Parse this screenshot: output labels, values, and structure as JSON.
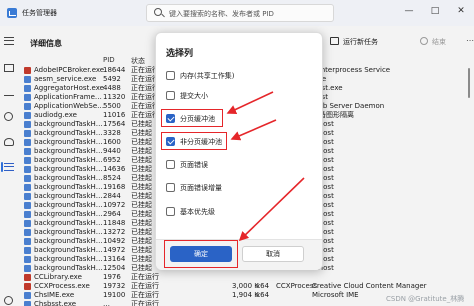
{
  "window": {
    "title": "任务管理器",
    "search_placeholder": "键入要搜索的名称、发布者或 PID",
    "minimize": "—",
    "maximize": "□",
    "close": "✕"
  },
  "page": {
    "title": "详细信息",
    "run_task": "运行新任务",
    "end_task": "结束"
  },
  "columns": {
    "pid": "PID",
    "status": "状态"
  },
  "rows": [
    {
      "name": "AdobeIPCBroker.exe",
      "pid": "18644",
      "status": "正在运行",
      "desc": "d Interprocess Service",
      "icon": "#c0392b"
    },
    {
      "name": "aesm_service.exe",
      "pid": "5492",
      "status": "正在运行",
      "desc": "vice",
      "icon": "#4a7fcf"
    },
    {
      "name": "AggregatorHost.exe",
      "pid": "4488",
      "status": "正在运行",
      "desc": "Host.exe",
      "icon": "#4a7fcf"
    },
    {
      "name": "ApplicationFrame…",
      "pid": "11320",
      "status": "正在运行",
      "desc": "Host",
      "icon": "#4a7fcf"
    },
    {
      "name": "ApplicationWebSe…",
      "pid": "5500",
      "status": "正在运行",
      "desc": "Web Server Daemon",
      "icon": "#4a7fcf"
    },
    {
      "name": "audiodg.exe",
      "pid": "11016",
      "status": "正在运行",
      "desc": "设备图形隔离",
      "icon": "#4a7fcf"
    },
    {
      "name": "backgroundTaskH…",
      "pid": "17564",
      "status": "已挂起",
      "desc": "s Host",
      "icon": "#4a7fcf"
    },
    {
      "name": "backgroundTaskH…",
      "pid": "3328",
      "status": "已挂起",
      "desc": "s Host",
      "icon": "#4a7fcf"
    },
    {
      "name": "backgroundTaskH…",
      "pid": "1600",
      "status": "已挂起",
      "desc": "s Host",
      "icon": "#4a7fcf"
    },
    {
      "name": "backgroundTaskH…",
      "pid": "9440",
      "status": "已挂起",
      "desc": "s Host",
      "icon": "#4a7fcf"
    },
    {
      "name": "backgroundTaskH…",
      "pid": "6952",
      "status": "已挂起",
      "desc": "s Host",
      "icon": "#4a7fcf"
    },
    {
      "name": "backgroundTaskH…",
      "pid": "14636",
      "status": "已挂起",
      "desc": "s Host",
      "icon": "#4a7fcf"
    },
    {
      "name": "backgroundTaskH…",
      "pid": "8524",
      "status": "已挂起",
      "desc": "s Host",
      "icon": "#4a7fcf"
    },
    {
      "name": "backgroundTaskH…",
      "pid": "19168",
      "status": "已挂起",
      "desc": "s Host",
      "icon": "#4a7fcf"
    },
    {
      "name": "backgroundTaskH…",
      "pid": "2844",
      "status": "已挂起",
      "desc": "s Host",
      "icon": "#4a7fcf"
    },
    {
      "name": "backgroundTaskH…",
      "pid": "10972",
      "status": "已挂起",
      "desc": "s Host",
      "icon": "#4a7fcf"
    },
    {
      "name": "backgroundTaskH…",
      "pid": "2964",
      "status": "已挂起",
      "desc": "s Host",
      "icon": "#4a7fcf"
    },
    {
      "name": "backgroundTaskH…",
      "pid": "11848",
      "status": "已挂起",
      "desc": "s Host",
      "icon": "#4a7fcf"
    },
    {
      "name": "backgroundTaskH…",
      "pid": "13272",
      "status": "已挂起",
      "desc": "s Host",
      "icon": "#4a7fcf"
    },
    {
      "name": "backgroundTaskH…",
      "pid": "10492",
      "status": "已挂起",
      "desc": "s Host",
      "icon": "#4a7fcf"
    },
    {
      "name": "backgroundTaskH…",
      "pid": "14972",
      "status": "已挂起",
      "desc": "s Host",
      "icon": "#4a7fcf"
    },
    {
      "name": "backgroundTaskH…",
      "pid": "13164",
      "status": "已挂起",
      "desc": "s Host",
      "icon": "#4a7fcf"
    },
    {
      "name": "backgroundTaskH…",
      "pid": "12504",
      "status": "已挂起",
      "desc": "s Host",
      "icon": "#4a7fcf"
    },
    {
      "name": "CCLibrary.exe",
      "pid": "1976",
      "status": "正在运行",
      "desc": "",
      "icon": "#c0392b"
    },
    {
      "name": "CCXProcess.exe",
      "pid": "19732",
      "status": "正在运行",
      "desc": "Creative Cloud Content Manager",
      "icon": "#c0392b",
      "mem": "3,000 K",
      "k": "x64",
      "extra": "CCXProcess"
    },
    {
      "name": "ChsIME.exe",
      "pid": "19100",
      "status": "正在运行",
      "desc": "Microsoft IME",
      "icon": "#4a7fcf",
      "mem": "1,904 K",
      "k": "x64",
      "extra": ""
    },
    {
      "name": "Chsbsst.exe",
      "pid": "…",
      "status": "正在运行",
      "desc": "",
      "icon": "#4a7fcf"
    }
  ],
  "dialog": {
    "title": "选择列",
    "options": [
      {
        "label": "内存(共享工作集)",
        "checked": false
      },
      {
        "label": "提交大小",
        "checked": false
      },
      {
        "label": "分页缓冲池",
        "checked": true
      },
      {
        "label": "非分页缓冲池",
        "checked": true
      },
      {
        "label": "页面错误",
        "checked": false
      },
      {
        "label": "页面错误增量",
        "checked": false
      },
      {
        "label": "基本优先级",
        "checked": false
      }
    ],
    "ok": "确定",
    "cancel": "取消"
  },
  "watermark": "CSDN @Gratitute_林腾",
  "colors": {
    "accent": "#2a63c6",
    "annotation": "#e5262a"
  }
}
